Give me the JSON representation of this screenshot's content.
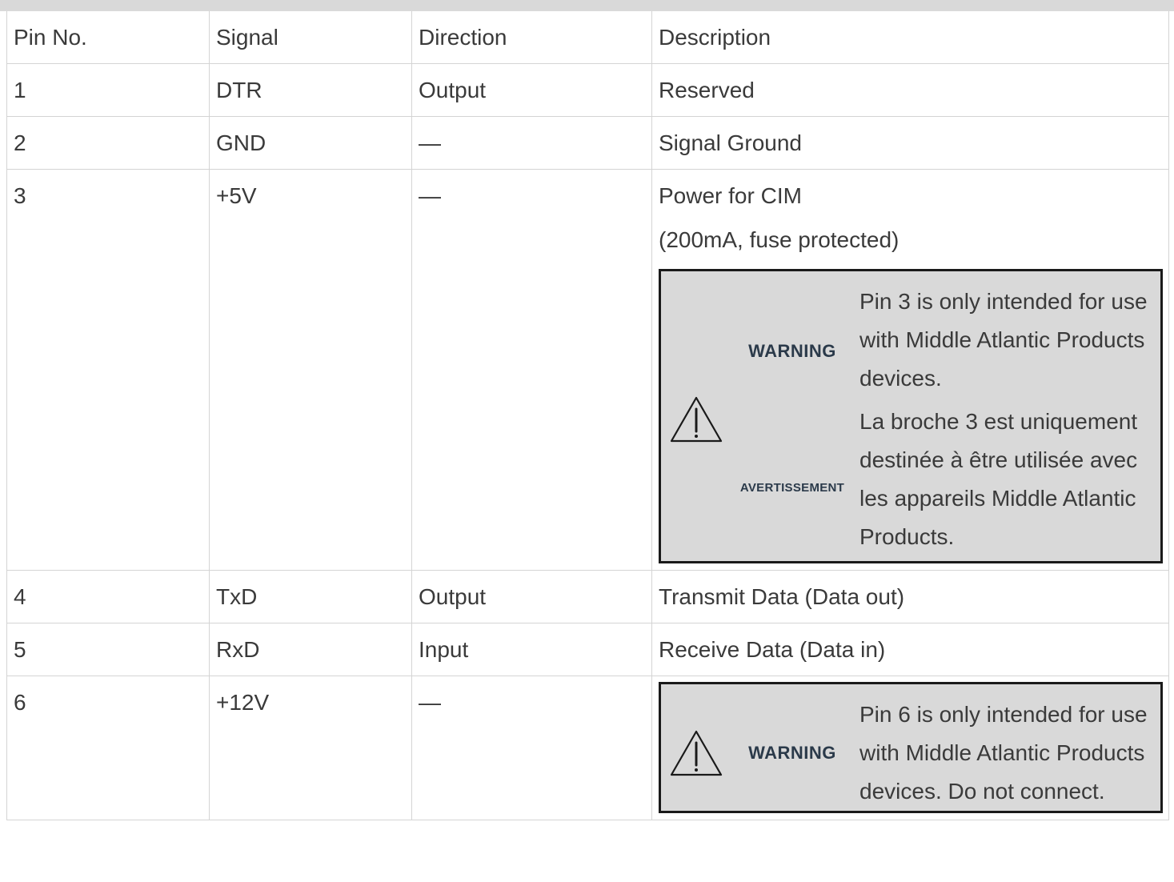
{
  "table": {
    "headers": [
      "Pin No.",
      "Signal",
      "Direction",
      "Description"
    ],
    "rows": [
      {
        "pin": "1",
        "signal": "DTR",
        "direction": "Output",
        "description": "Reserved"
      },
      {
        "pin": "2",
        "signal": "GND",
        "direction": "—",
        "description": "Signal Ground"
      },
      {
        "pin": "3",
        "signal": "+5V",
        "direction": "—",
        "description_lines": [
          "Power for CIM",
          "(200mA, fuse protected)"
        ]
      },
      {
        "pin": "4",
        "signal": "TxD",
        "direction": "Output",
        "description": "Transmit Data (Data out)"
      },
      {
        "pin": "5",
        "signal": "RxD",
        "direction": "Input",
        "description": "Receive Data (Data in)"
      },
      {
        "pin": "6",
        "signal": "+12V",
        "direction": "—"
      }
    ]
  },
  "warning_pin3": {
    "icon": "warning-triangle-icon",
    "label_en": "WARNING",
    "text_en": "Pin 3 is only intended for use with Middle Atlantic Products devices.",
    "label_fr": "AVERTISSEMENT",
    "text_fr": "La broche 3 est uniquement destinée à être utilisée avec les appareils Middle Atlantic Products."
  },
  "warning_pin6": {
    "icon": "warning-triangle-icon",
    "label_en": "WARNING",
    "text_en": "Pin 6 is only intended for use with Middle Atlantic Products devices. Do not connect."
  },
  "colors": {
    "header_bar": "#d9d9d9",
    "warning_background": "#d9d9d9",
    "warning_border": "#1a1a1a",
    "label_color": "#2b3a4a"
  }
}
